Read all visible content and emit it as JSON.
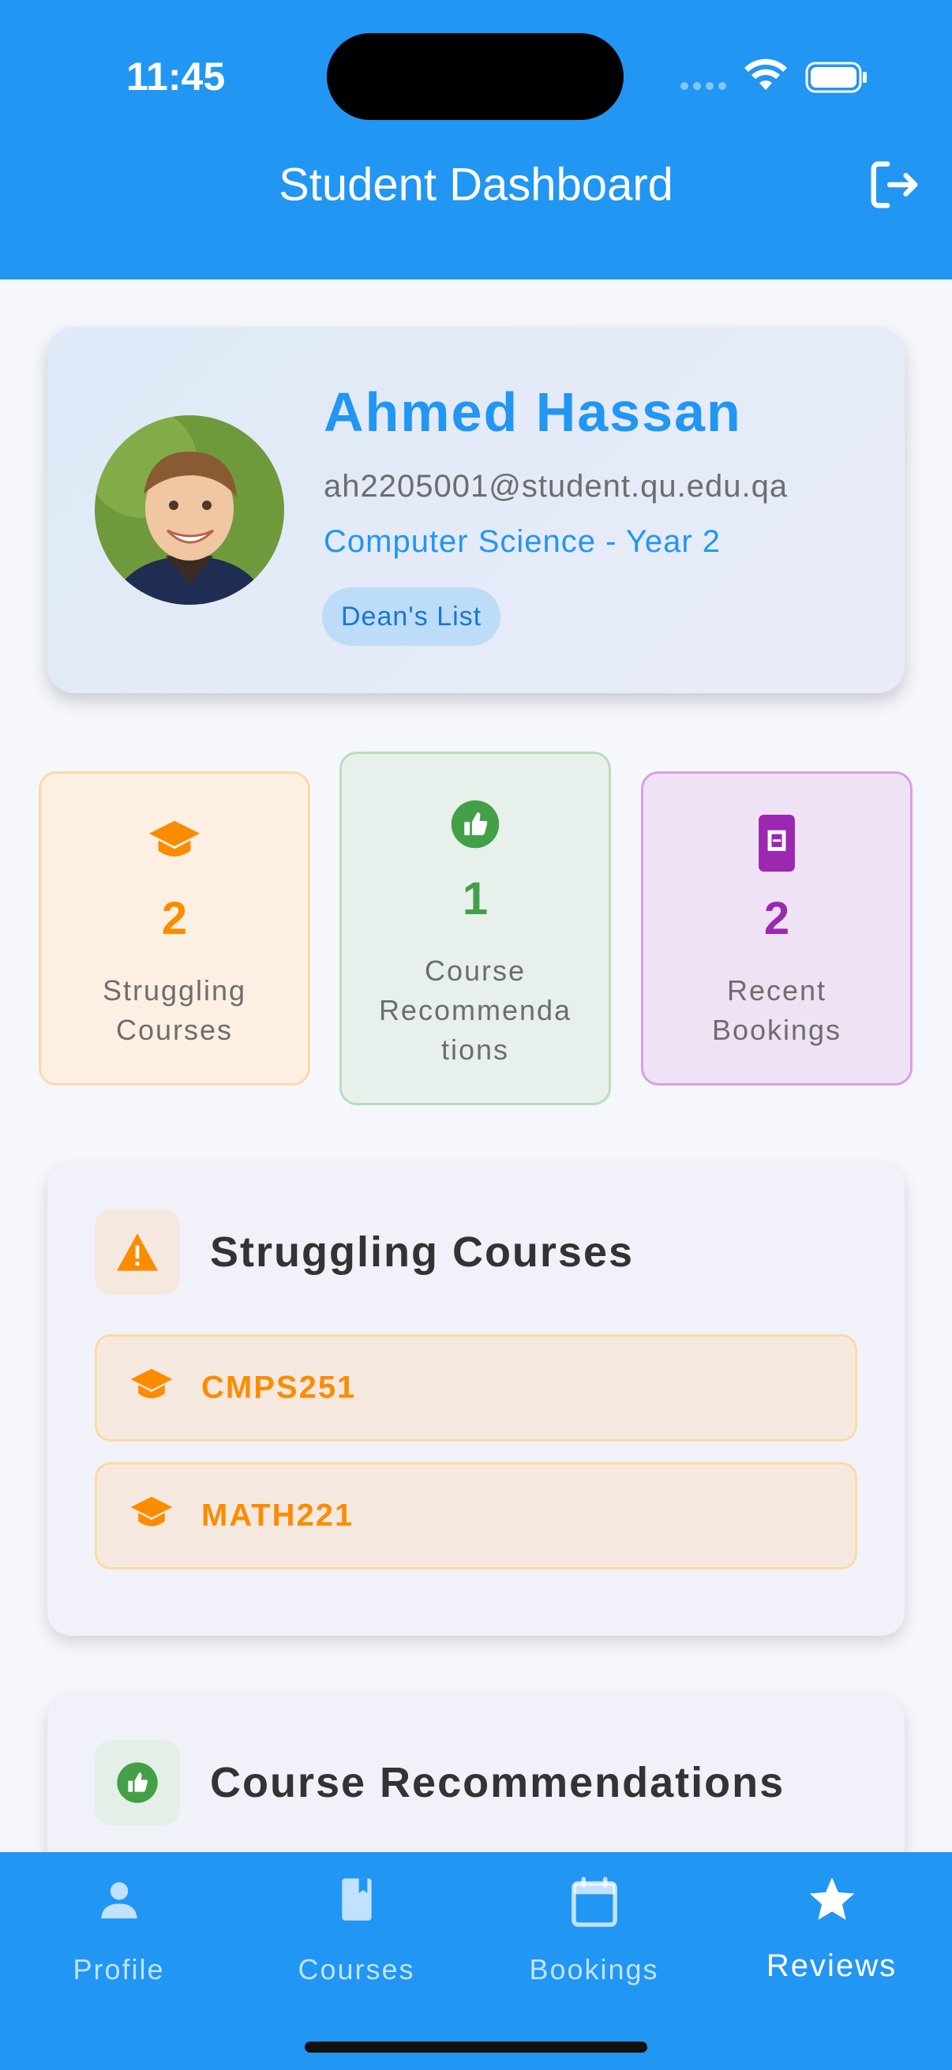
{
  "status_bar": {
    "time": "11:45"
  },
  "app_bar": {
    "title": "Student Dashboard",
    "logout_icon": "logout-icon"
  },
  "profile": {
    "name": "Ahmed Hassan",
    "email": "ah2205001@student.qu.edu.qa",
    "program": "Computer Science - Year 2",
    "badge": "Dean's List"
  },
  "stats": [
    {
      "value": "2",
      "label_lines": [
        "Struggling",
        "Courses"
      ],
      "icon": "graduation-cap-icon",
      "color": "#fb8c00"
    },
    {
      "value": "1",
      "label_lines": [
        "Course",
        "Recommenda",
        "tions"
      ],
      "icon": "thumbs-up-icon",
      "color": "#43a047"
    },
    {
      "value": "2",
      "label_lines": [
        "Recent",
        "Bookings"
      ],
      "icon": "ticket-icon",
      "color": "#9c27b0"
    }
  ],
  "struggling_section": {
    "title": "Struggling Courses",
    "icon": "warning-icon",
    "courses": [
      "CMPS251",
      "MATH221"
    ]
  },
  "recommendations_section": {
    "title": "Course Recommendations",
    "icon": "thumbs-up-icon"
  },
  "bottom_nav": {
    "items": [
      {
        "label": "Profile",
        "icon": "person-icon"
      },
      {
        "label": "Courses",
        "icon": "book-icon"
      },
      {
        "label": "Bookings",
        "icon": "calendar-icon"
      },
      {
        "label": "Reviews",
        "icon": "star-icon",
        "active": true
      }
    ]
  },
  "colors": {
    "primary": "#2196f3",
    "warning": "#fb8c00",
    "success": "#43a047",
    "purple": "#9c27b0"
  }
}
